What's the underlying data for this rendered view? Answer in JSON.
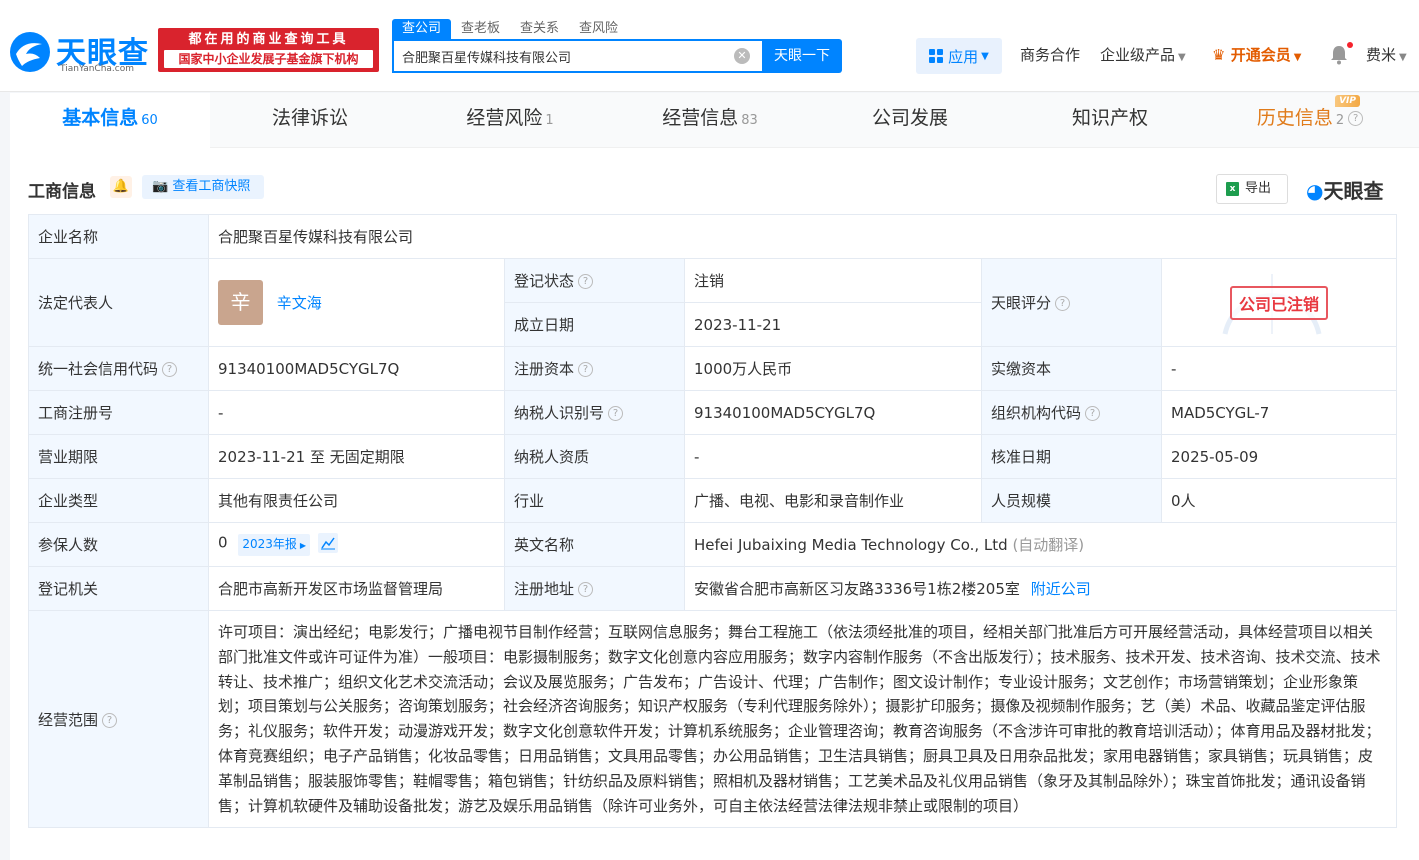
{
  "header": {
    "logo_text": "天眼查",
    "logo_sub": "TianYanCha.com",
    "banner_line1": "都在用的商业查询工具",
    "banner_line2": "国家中小企业发展子基金旗下机构",
    "search_tabs": [
      "查公司",
      "查老板",
      "查关系",
      "查风险"
    ],
    "search_value": "合肥聚百星传媒科技有限公司",
    "search_button": "天眼一下",
    "app_label": "应用",
    "nav": {
      "business": "商务合作",
      "enterprise": "企业级产品",
      "vip": "开通会员",
      "user": "费米"
    }
  },
  "tabs": [
    {
      "label": "基本信息",
      "count": "60"
    },
    {
      "label": "法律诉讼",
      "count": ""
    },
    {
      "label": "经营风险",
      "count": "1"
    },
    {
      "label": "经营信息",
      "count": "83"
    },
    {
      "label": "公司发展",
      "count": ""
    },
    {
      "label": "知识产权",
      "count": ""
    },
    {
      "label": "历史信息",
      "count": "2",
      "badge": "VIP"
    }
  ],
  "section": {
    "title": "工商信息",
    "snapshot_button": "查看工商快照",
    "export_button": "导出",
    "brand": "天眼查"
  },
  "info": {
    "company_name_label": "企业名称",
    "company_name": "合肥聚百星传媒科技有限公司",
    "legal_rep_label": "法定代表人",
    "legal_rep_avatar": "辛",
    "legal_rep": "辛文海",
    "reg_status_label": "登记状态",
    "reg_status": "注销",
    "founded_label": "成立日期",
    "founded": "2023-11-21",
    "score_label": "天眼评分",
    "score_stamp": "公司已注销",
    "credit_code_label": "统一社会信用代码",
    "credit_code": "91340100MAD5CYGL7Q",
    "reg_capital_label": "注册资本",
    "reg_capital": "1000万人民币",
    "paid_capital_label": "实缴资本",
    "paid_capital": "-",
    "reg_no_label": "工商注册号",
    "reg_no": "-",
    "tax_id_label": "纳税人识别号",
    "tax_id": "91340100MAD5CYGL7Q",
    "org_code_label": "组织机构代码",
    "org_code": "MAD5CYGL-7",
    "term_label": "营业期限",
    "term": "2023-11-21 至 无固定期限",
    "tax_qual_label": "纳税人资质",
    "tax_qual": "-",
    "approval_label": "核准日期",
    "approval": "2025-05-09",
    "type_label": "企业类型",
    "type": "其他有限责任公司",
    "industry_label": "行业",
    "industry": "广播、电视、电影和录音制作业",
    "staff_label": "人员规模",
    "staff": "0人",
    "insured_label": "参保人数",
    "insured": "0",
    "insured_year": "2023年报",
    "english_label": "英文名称",
    "english": "Hefei Jubaixing Media Technology Co., Ltd",
    "english_note": "(自动翻译)",
    "authority_label": "登记机关",
    "authority": "合肥市高新开发区市场监督管理局",
    "address_label": "注册地址",
    "address": "安徽省合肥市高新区习友路3336号1栋2楼205室",
    "nearby": "附近公司",
    "scope_label": "经营范围",
    "scope": "许可项目：演出经纪；电影发行；广播电视节目制作经营；互联网信息服务；舞台工程施工（依法须经批准的项目，经相关部门批准后方可开展经营活动，具体经营项目以相关部门批准文件或许可证件为准）一般项目：电影摄制服务；数字文化创意内容应用服务；数字内容制作服务（不含出版发行）；技术服务、技术开发、技术咨询、技术交流、技术转让、技术推广；组织文化艺术交流活动；会议及展览服务；广告发布；广告设计、代理；广告制作；图文设计制作；专业设计服务；文艺创作；市场营销策划；企业形象策划；项目策划与公关服务；咨询策划服务；社会经济咨询服务；知识产权服务（专利代理服务除外）；摄影扩印服务；摄像及视频制作服务；艺（美）术品、收藏品鉴定评估服务；礼仪服务；软件开发；动漫游戏开发；数字文化创意软件开发；计算机系统服务；企业管理咨询；教育咨询服务（不含涉许可审批的教育培训活动）；体育用品及器材批发；体育竞赛组织；电子产品销售；化妆品零售；日用品销售；文具用品零售；办公用品销售；卫生洁具销售；厨具卫具及日用杂品批发；家用电器销售；家具销售；玩具销售；皮革制品销售；服装服饰零售；鞋帽零售；箱包销售；针纺织品及原料销售；照相机及器材销售；工艺美术品及礼仪用品销售（象牙及其制品除外）；珠宝首饰批发；通讯设备销售；计算机软硬件及辅助设备批发；游艺及娱乐用品销售（除许可业务外，可自主依法经营法律法规非禁止或限制的项目）"
  },
  "colors": {
    "accent": "#0084ff",
    "status": "#f5222d",
    "banner": "#d9232d"
  }
}
